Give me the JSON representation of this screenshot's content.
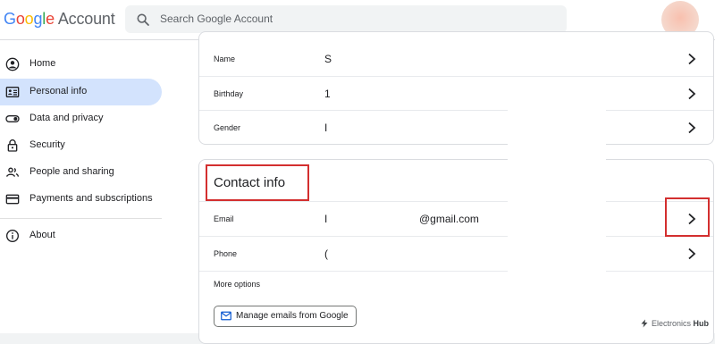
{
  "header": {
    "logo_letters": [
      "G",
      "o",
      "o",
      "g",
      "l",
      "e"
    ],
    "logo_suffix": "Account",
    "search_placeholder": "Search Google Account"
  },
  "sidebar": {
    "items": [
      {
        "label": "Home",
        "icon": "account-circle-icon"
      },
      {
        "label": "Personal info",
        "icon": "id-card-icon",
        "active": true
      },
      {
        "label": "Data and privacy",
        "icon": "toggle-icon"
      },
      {
        "label": "Security",
        "icon": "lock-icon"
      },
      {
        "label": "People and sharing",
        "icon": "people-icon"
      },
      {
        "label": "Payments and subscriptions",
        "icon": "credit-card-icon"
      },
      {
        "label": "About",
        "icon": "info-icon"
      }
    ]
  },
  "basic_info": {
    "rows": [
      {
        "label": "Name",
        "value": "S"
      },
      {
        "label": "Birthday",
        "value": "1"
      },
      {
        "label": "Gender",
        "value": "I"
      }
    ]
  },
  "contact_info": {
    "title": "Contact info",
    "rows": [
      {
        "label": "Email",
        "value": "@gmail.com",
        "value_prefix": "I"
      },
      {
        "label": "Phone",
        "value": "("
      }
    ],
    "more_options": "More options",
    "manage_button": "Manage emails from Google"
  },
  "watermark": {
    "brand": "Electronics",
    "suffix": "Hub"
  },
  "colors": {
    "active_nav": "#d3e3fd",
    "highlight_box": "#d32f2f"
  }
}
